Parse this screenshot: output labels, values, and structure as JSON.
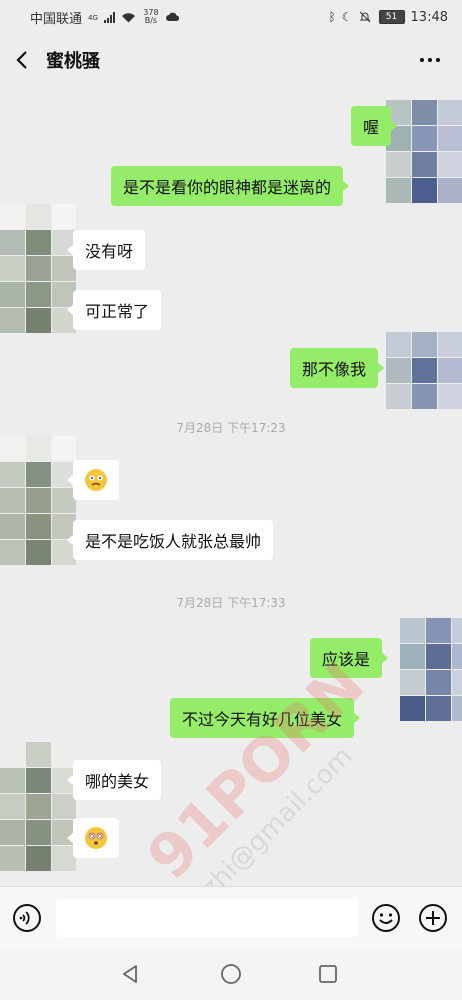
{
  "status_bar": {
    "carrier": "中国联通",
    "network": "4G",
    "net_speed_value": "378",
    "net_speed_unit": "B/s",
    "battery": "51",
    "time": "13:48"
  },
  "header": {
    "title": "蜜桃骚"
  },
  "messages": [
    {
      "side": "out",
      "text": "喔"
    },
    {
      "side": "out",
      "text": "是不是看你的眼神都是迷离的"
    },
    {
      "side": "in",
      "text": "没有呀"
    },
    {
      "side": "in",
      "text": "可正常了"
    },
    {
      "side": "out",
      "text": "那不像我"
    },
    {
      "side": "in",
      "emoji": "confused-face"
    },
    {
      "side": "in",
      "text": "是不是吃饭人就张总最帅"
    },
    {
      "side": "out",
      "text": "应该是"
    },
    {
      "side": "out",
      "text": "不过今天有好几位美女"
    },
    {
      "side": "in",
      "text": "哪的美女"
    },
    {
      "side": "in",
      "emoji": "dizzy-face"
    }
  ],
  "timestamps": [
    "7月28日 下午17:23",
    "7月28日 下午17:33"
  ],
  "watermark": {
    "main": "91PORN",
    "sub": "fizhi@gmail.com"
  },
  "input_bar": {
    "value": "",
    "placeholder": ""
  },
  "colors": {
    "background": "#ededed",
    "bubble_out": "#95ec69",
    "bubble_in": "#ffffff",
    "timestamp": "#aaaaaa"
  }
}
